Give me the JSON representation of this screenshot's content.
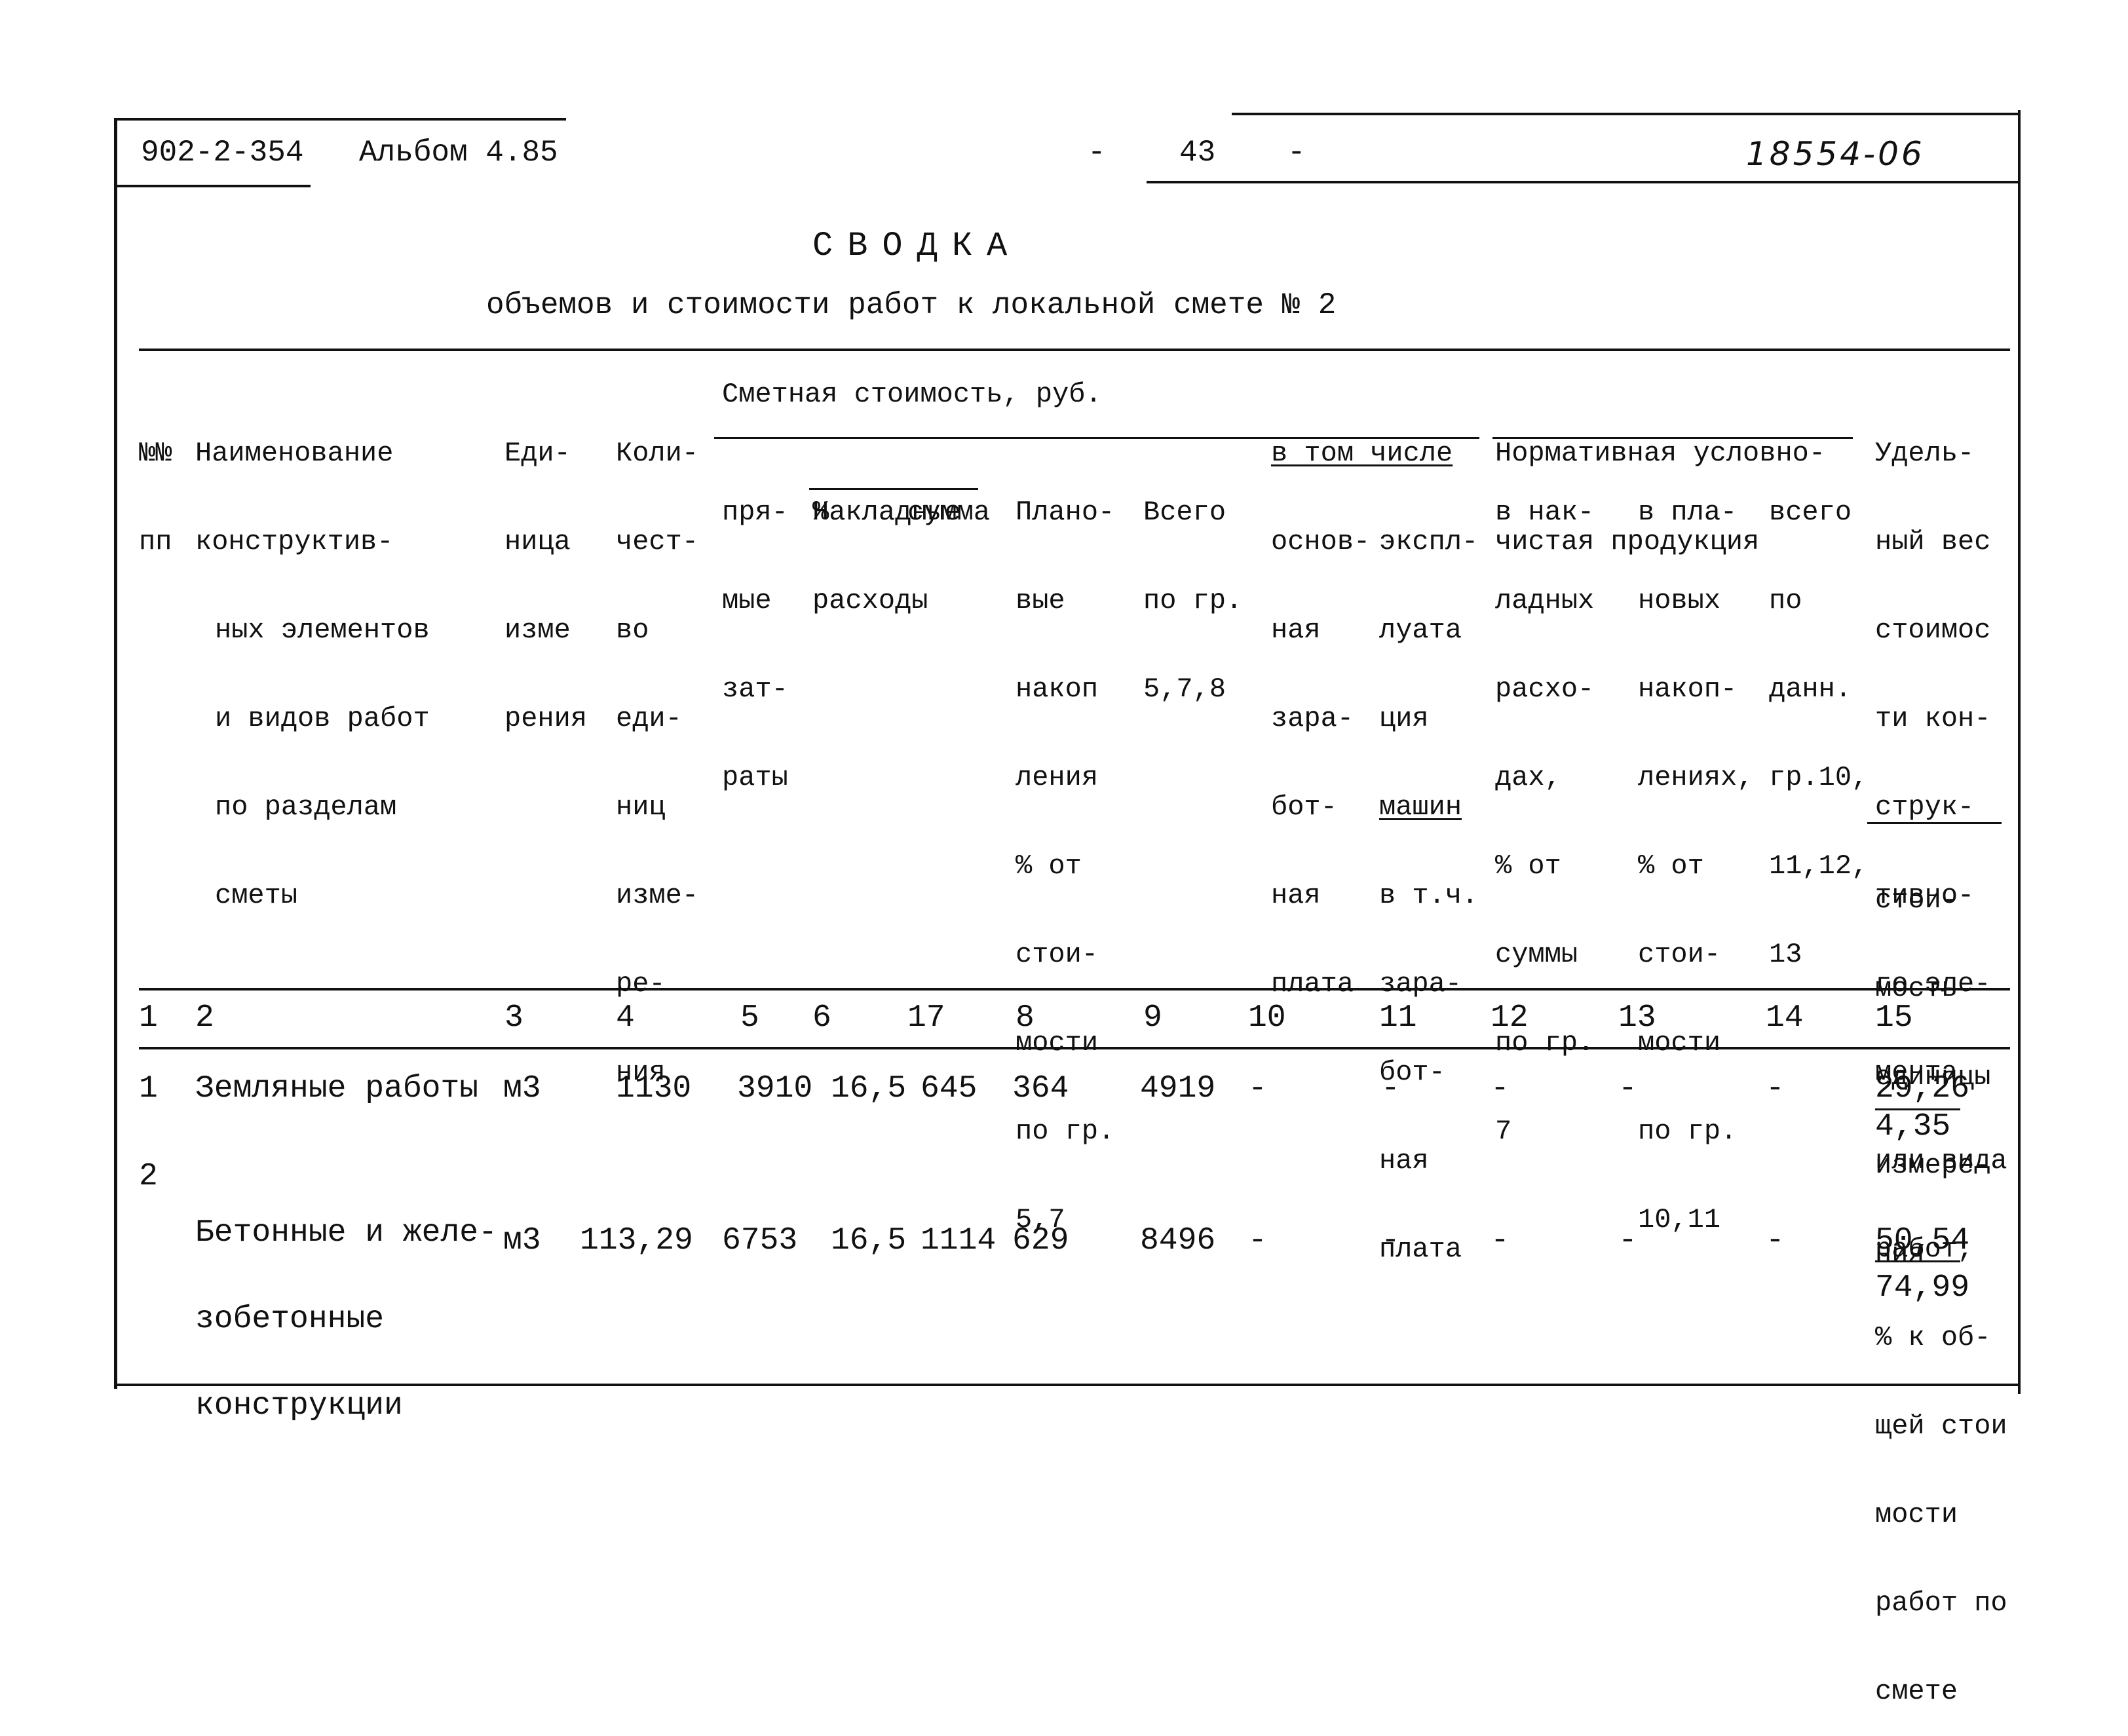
{
  "header": {
    "doc_code": "902-2-354",
    "album": "Альбом 4.85",
    "page_dash_left": "-",
    "page_number": "43",
    "page_dash_right": "-",
    "handwritten_number": "18554-06"
  },
  "title": "СВОДКА",
  "subtitle": "объемов и стоимости работ к локальной смете № 2",
  "table": {
    "headers": {
      "col1": [
        "№№",
        "пп"
      ],
      "col2": [
        "Наименование",
        "конструктив-",
        "ных элементов",
        "и видов работ",
        "по разделам",
        "сметы"
      ],
      "col3": [
        "Еди-",
        "ница",
        "изме",
        "рения"
      ],
      "col4": [
        "Коли-",
        "чест-",
        "во",
        "еди-",
        "ниц",
        "изме-",
        "ре-",
        "ния"
      ],
      "group_cost": "Сметная стоимость, руб.",
      "col5": [
        "пря-",
        "мые",
        "зат-",
        "раты"
      ],
      "overhead_group": [
        "Накладные",
        "расходы"
      ],
      "col6": "%",
      "col7": "сумма",
      "col8": [
        "Плано-",
        "вые",
        "накоп",
        "ления",
        "% от",
        "стои-",
        "мости",
        "по гр.",
        "5,7"
      ],
      "col9": [
        "Всего",
        "по гр.",
        "5,7,8"
      ],
      "incl_group": "в том числе",
      "col10": [
        "основ-",
        "ная",
        "зара-",
        "бот-",
        "ная",
        "плата"
      ],
      "col11": [
        "экспл-",
        "луата",
        "ция",
        "машин",
        "в т.ч.",
        "зара-",
        "бот-",
        "ная",
        "плата"
      ],
      "group_norm": [
        "Нормативная условно-",
        "чистая продукция"
      ],
      "col12": [
        "в нак-",
        "ладных",
        "расхо-",
        "дах,",
        "% от",
        "суммы",
        "по гр.",
        "7"
      ],
      "col13": [
        "в пла-",
        "новых",
        "накоп-",
        "лениях,",
        "% от",
        "стои-",
        "мости",
        "по гр.",
        "10,11"
      ],
      "col14": [
        "всего",
        "по",
        "данн.",
        "гр.10,",
        "11,12,",
        "13"
      ],
      "col15_top": [
        "Удель-",
        "ный вес",
        "стоимос",
        "ти кон-",
        "струк-",
        "тивно-",
        "го эле-",
        "мента",
        "или вида",
        "работ,",
        "% к об-",
        "щей стои",
        "мости",
        "работ по",
        "смете"
      ],
      "col15_bottom": [
        "стои-",
        "мость",
        "единицы",
        "измере-",
        "ния"
      ]
    },
    "column_numbers": [
      "1",
      "2",
      "3",
      "4",
      "5",
      "6",
      "17",
      "8",
      "9",
      "10",
      "11",
      "12",
      "13",
      "14",
      "15"
    ],
    "rows": [
      {
        "num": "1",
        "name": [
          "Земляные работы"
        ],
        "unit": "м3",
        "qty": "1130",
        "direct": "3910",
        "overhead_pct": "16,5",
        "overhead_sum": "645",
        "planned": "364",
        "total": "4919",
        "c10": "-",
        "c11": "-",
        "c12": "-",
        "c13": "-",
        "c14": "-",
        "share_pct": "29,26",
        "unit_cost": "4,35"
      },
      {
        "num": "2",
        "name": [
          "Бетонные и желе-",
          "зобетонные",
          "конструкции"
        ],
        "unit": "м3",
        "qty": "113,29",
        "direct": "6753",
        "overhead_pct": "16,5",
        "overhead_sum": "1114",
        "planned": "629",
        "total": "8496",
        "c10": "-",
        "c11": "-",
        "c12": "-",
        "c13": "-",
        "c14": "-",
        "share_pct": "50,54",
        "unit_cost": "74,99"
      }
    ]
  }
}
